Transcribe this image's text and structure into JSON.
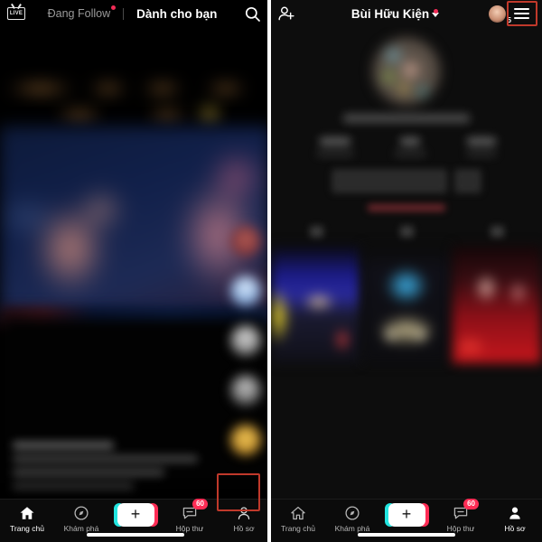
{
  "left_panel": {
    "top_bar": {
      "live_label": "LIVE",
      "live_icon": "live-tv-icon",
      "tabs": [
        {
          "label": "Đang Follow",
          "active": false,
          "has_dot": true
        },
        {
          "label": "Dành cho bạn",
          "active": true,
          "has_dot": false
        }
      ],
      "search_icon": "search-icon"
    },
    "video": {
      "rail_icons": [
        "profile-avatar-icon",
        "heart-icon",
        "comment-icon",
        "share-icon",
        "music-disc-icon"
      ],
      "caption_blurred": true
    },
    "nav": {
      "items": [
        {
          "label": "Trang chủ",
          "icon": "home-icon",
          "active": true,
          "badge": ""
        },
        {
          "label": "Khám phá",
          "icon": "compass-icon",
          "active": false,
          "badge": ""
        },
        {
          "label": "",
          "icon": "create-plus-icon",
          "active": false,
          "badge": ""
        },
        {
          "label": "Hộp thư",
          "icon": "inbox-icon",
          "active": false,
          "badge": "60"
        },
        {
          "label": "Hồ sơ",
          "icon": "person-icon",
          "active": false,
          "badge": ""
        }
      ],
      "create_plus": "+"
    },
    "highlight": {
      "target": "Hồ sơ",
      "color": "#c0392b"
    }
  },
  "right_panel": {
    "top_bar": {
      "add_friend_icon": "add-person-icon",
      "username": "Bùi Hữu Kiện",
      "chevron_icon": "chevron-down-icon",
      "has_notification_dot": true,
      "avatar_badge": "5",
      "menu_icon": "hamburger-menu-icon"
    },
    "profile": {
      "avatar_icon": "profile-avatar",
      "username_blurred": true,
      "stats_blurred": true,
      "actions_blurred": true,
      "grid_items": 3
    },
    "nav": {
      "items": [
        {
          "label": "Trang chủ",
          "icon": "home-icon",
          "active": false,
          "badge": ""
        },
        {
          "label": "Khám phá",
          "icon": "compass-icon",
          "active": false,
          "badge": ""
        },
        {
          "label": "",
          "icon": "create-plus-icon",
          "active": false,
          "badge": ""
        },
        {
          "label": "Hộp thư",
          "icon": "inbox-icon",
          "active": false,
          "badge": "60"
        },
        {
          "label": "Hồ sơ",
          "icon": "person-icon",
          "active": true,
          "badge": ""
        }
      ],
      "create_plus": "+"
    },
    "highlight": {
      "target": "hamburger-menu",
      "color": "#c0392b"
    }
  },
  "colors": {
    "accent_pink": "#fe2c55",
    "accent_cyan": "#22e5e0",
    "highlight_red": "#c0392b",
    "background": "#000000"
  }
}
